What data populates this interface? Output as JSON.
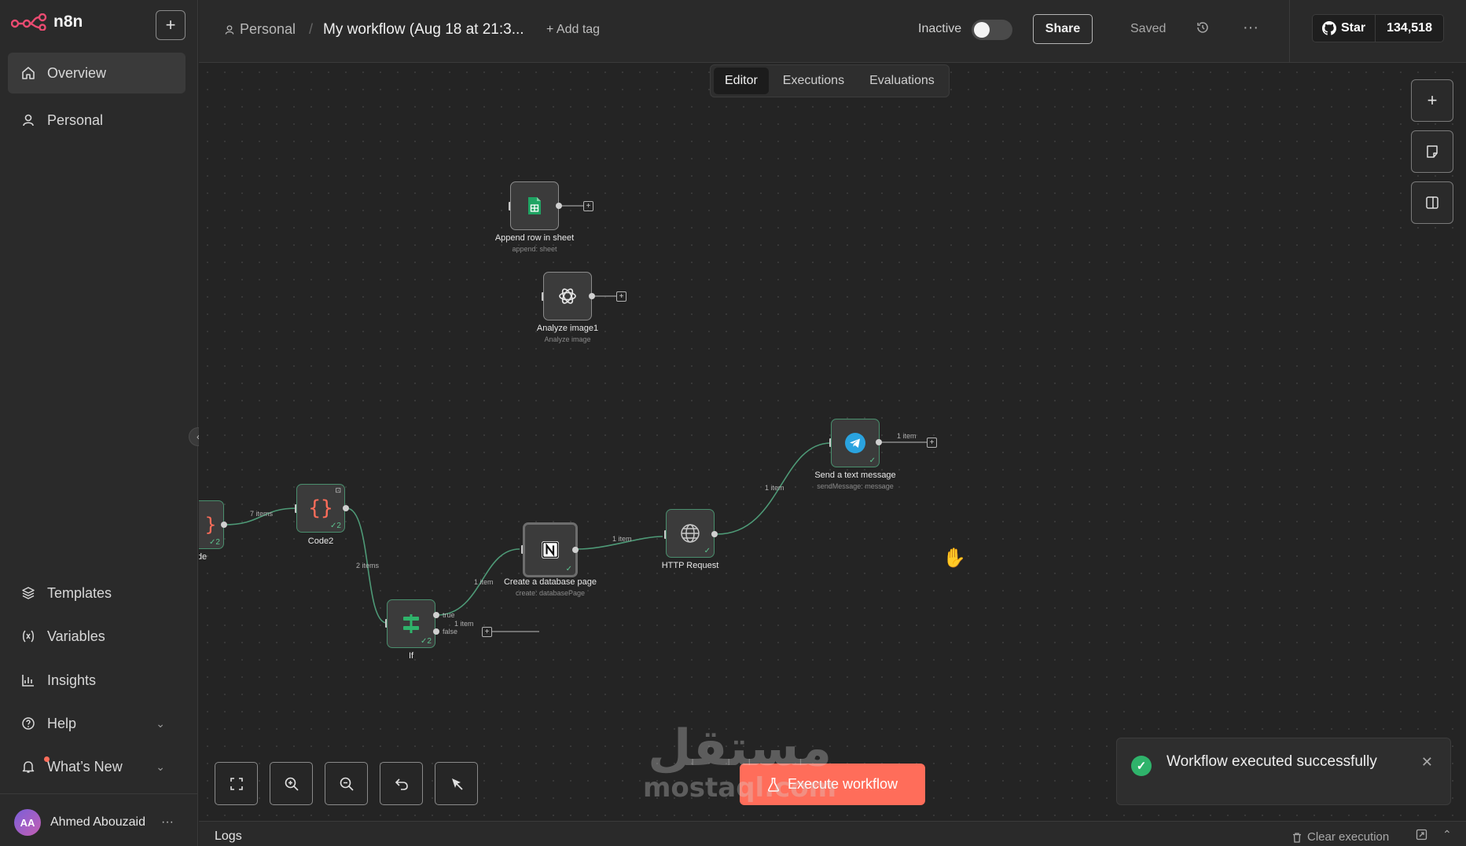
{
  "sidebar": {
    "brand": "n8n",
    "nav_top": [
      {
        "label": "Overview",
        "icon": "home-icon"
      },
      {
        "label": "Personal",
        "icon": "user-icon"
      }
    ],
    "nav_bottom": [
      {
        "label": "Templates",
        "icon": "templates-icon"
      },
      {
        "label": "Variables",
        "icon": "variables-icon"
      },
      {
        "label": "Insights",
        "icon": "insights-icon"
      },
      {
        "label": "Help",
        "icon": "help-icon"
      },
      {
        "label": "What’s New",
        "icon": "bell-icon"
      }
    ],
    "user": {
      "initials": "AA",
      "name": "Ahmed Abouzaid"
    }
  },
  "header": {
    "project": "Personal",
    "workflow_title": "My workflow (Aug 18 at 21:3...",
    "add_tag": "+ Add tag",
    "status_label": "Inactive",
    "share": "Share",
    "saved": "Saved",
    "github_star": "Star",
    "github_count": "134,518"
  },
  "tabs": [
    {
      "label": "Editor",
      "active": true
    },
    {
      "label": "Executions",
      "active": false
    },
    {
      "label": "Evaluations",
      "active": false
    }
  ],
  "nodes": {
    "append": {
      "label": "Append row in sheet",
      "sub": "append: sheet",
      "icon": "google-sheets-icon"
    },
    "analyze": {
      "label": "Analyze image1",
      "sub": "Analyze image",
      "icon": "openai-icon"
    },
    "telegram": {
      "label": "Send a text message",
      "sub": "sendMessage: message",
      "icon": "telegram-icon",
      "check": "✓"
    },
    "code_partial": {
      "label": "ode",
      "check": "✓2"
    },
    "code2": {
      "label": "Code2",
      "check": "✓2"
    },
    "if_node": {
      "label": "If",
      "check": "✓2",
      "true_label": "true",
      "false_label": "false"
    },
    "notion": {
      "label": "Create a database page",
      "sub": "create: databasePage",
      "icon": "notion-icon",
      "check": "✓"
    },
    "http": {
      "label": "HTTP Request",
      "icon": "globe-icon",
      "check": "✓"
    }
  },
  "edges": {
    "code_to_code2": "7 items",
    "code2_to_if": "2 items",
    "if_to_notion": "1 item",
    "if_false": "1 item",
    "notion_to_http": "1 item",
    "http_to_telegram": "1 item",
    "telegram_out": "1 item"
  },
  "execute_button": "Execute workflow",
  "toast": {
    "message": "Workflow executed successfully"
  },
  "watermark": {
    "arabic": "مستقل",
    "latin": "mostaql.com"
  },
  "logs": {
    "label": "Logs",
    "clear": "Clear execution"
  },
  "colors": {
    "accent": "#ff6d5a",
    "success": "#2fb36b",
    "canvas": "#242424",
    "sidebar": "#2a2a2a"
  }
}
